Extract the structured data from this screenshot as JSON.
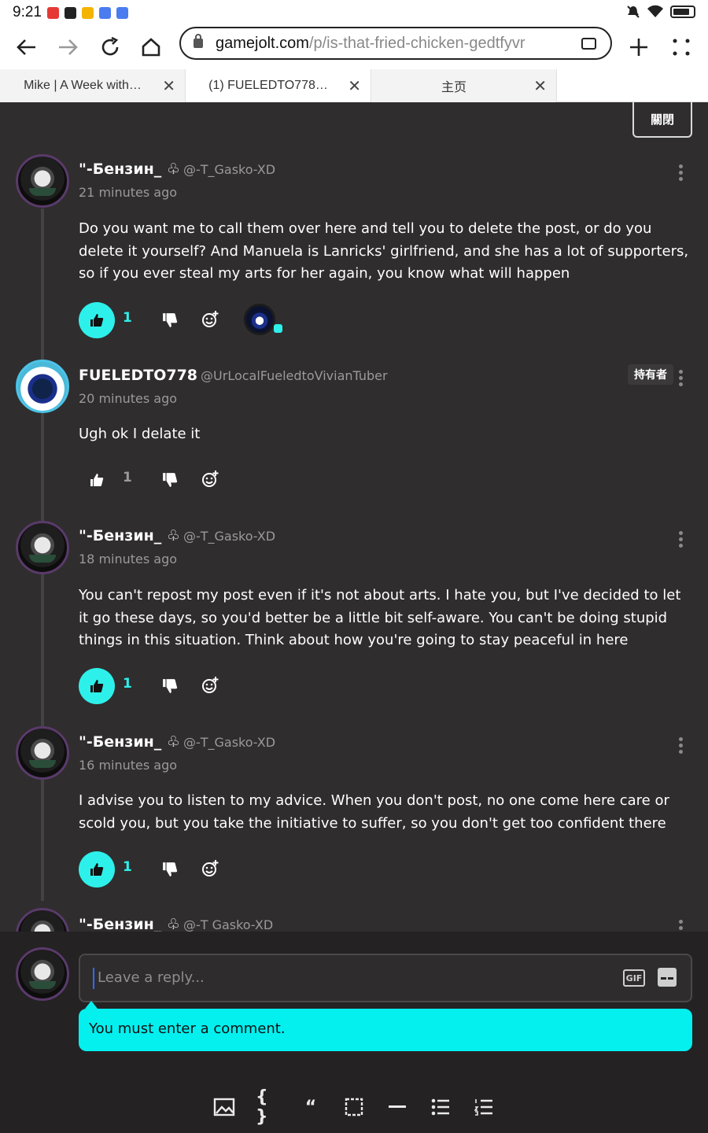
{
  "status_bar": {
    "time": "9:21"
  },
  "browser": {
    "url_host": "gamejolt.com",
    "url_path": "/p/is-that-fried-chicken-gedtfyvr",
    "tabs": [
      {
        "label": "Mike | A Week with…",
        "active": false
      },
      {
        "label": "(1) FUELEDTO778…",
        "active": true
      },
      {
        "label": "主页",
        "active": false
      }
    ]
  },
  "close_button": "關閉",
  "comments": [
    {
      "name": "\"-Бензин_",
      "handle": "@-T_Gasko-XD",
      "time": "21 minutes ago",
      "text": "Do you want me to call them over here and tell you to delete the post, or do you delete it yourself? And Manuela is Lanricks' girlfriend, and she has a lot of supporters, so if you ever steal my arts for her again, you know what will happen",
      "likes": "1",
      "liked": true
    },
    {
      "name": "FUELEDTO778",
      "handle": "@UrLocalFueledtoVivianTuber",
      "time": "20 minutes ago",
      "text": "Ugh ok I delate it",
      "likes": "1",
      "liked": false,
      "badge": "持有者"
    },
    {
      "name": "\"-Бензин_",
      "handle": "@-T_Gasko-XD",
      "time": "18 minutes ago",
      "text": "You can't repost my post even if it's not about arts. I hate you, but I've decided to let it go these days, so you'd better be a little bit self-aware. You can't be doing stupid things in this situation. Think about how you're going to stay peaceful in here",
      "likes": "1",
      "liked": true
    },
    {
      "name": "\"-Бензин_",
      "handle": "@-T_Gasko-XD",
      "time": "16 minutes ago",
      "text": "I advise you to listen to my advice. When you don't post, no one come here care or scold you, but you take the initiative to suffer, so you don't get too confident there",
      "likes": "1",
      "liked": true
    },
    {
      "name": "\"-Бензин_",
      "handle": "@-T Gasko-XD"
    }
  ],
  "reply": {
    "placeholder": "Leave a reply...",
    "gif_label": "GIF",
    "validation_message": "You must enter a comment."
  },
  "colors": {
    "accent": "#2ef0ea",
    "background": "#2f2d2e",
    "tip": "#03f0ef"
  }
}
